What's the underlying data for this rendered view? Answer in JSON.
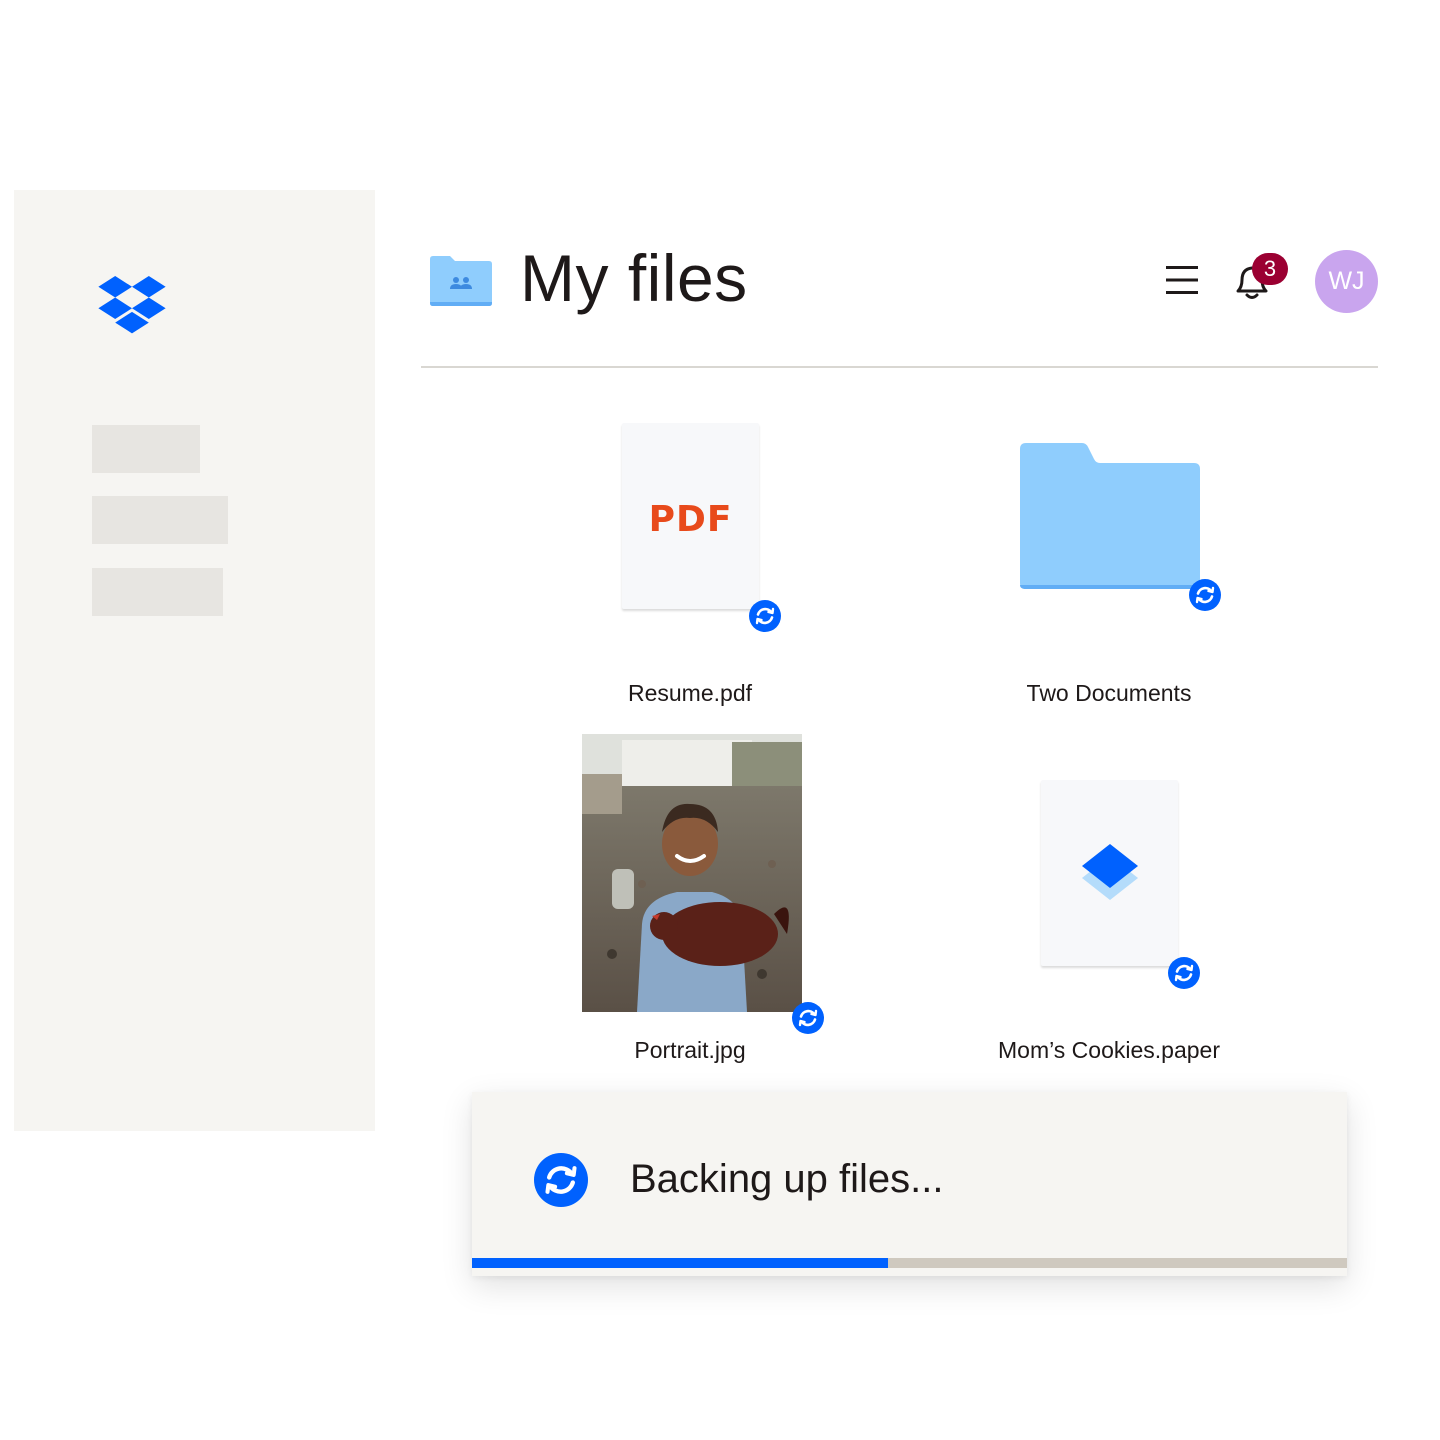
{
  "app": {
    "logo_icon": "dropbox-logo-icon",
    "accent_color": "#0061fe"
  },
  "header": {
    "title": "My files",
    "folder_icon": "shared-folder-icon",
    "menu_icon": "hamburger-menu-icon",
    "bell_icon": "bell-icon",
    "notification_count": "3",
    "avatar_initials": "WJ",
    "avatar_color": "#c9a5ee"
  },
  "files": [
    {
      "name": "Resume.pdf",
      "icon": "pdf-file-icon",
      "badge_text": "PDF",
      "sync_icon": "sync-icon"
    },
    {
      "name": "Two Documents",
      "icon": "folder-icon",
      "sync_icon": "sync-icon"
    },
    {
      "name": "Portrait.jpg",
      "icon": "photo-thumbnail",
      "sync_icon": "sync-icon"
    },
    {
      "name": "Mom’s Cookies.paper",
      "icon": "paper-doc-icon",
      "sync_icon": "sync-icon"
    }
  ],
  "toast": {
    "message": "Backing up files...",
    "icon": "sync-icon",
    "progress_percent": 47.5
  }
}
